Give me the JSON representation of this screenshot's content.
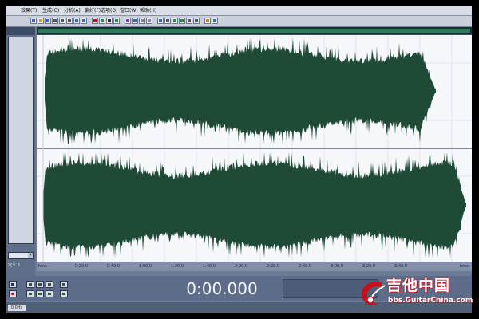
{
  "menu": {
    "items": [
      "效果(T)",
      "生成(G)",
      "分析(A)",
      "偏好(F)",
      "选项(O)",
      "窗口(W)",
      "帮助(H)"
    ]
  },
  "icons": {
    "toolbar": [
      "new-file-icon",
      "open-icon",
      "save-icon",
      "cut-icon",
      "copy-icon",
      "paste-icon",
      "undo-icon",
      "redo-icon",
      "record-icon",
      "play-icon",
      "stop-icon",
      "zoom-icon",
      "multitrack-icon",
      "edit-view-icon",
      "spectral-icon",
      "mix-icon",
      "loop-icon",
      "settings-icon",
      "marker-icon",
      "region-icon",
      "snap-icon",
      "grid-icon",
      "meter-icon",
      "cd-icon"
    ]
  },
  "left_panel": {
    "select_value": "",
    "footer_text": "定义 8"
  },
  "timeline": {
    "labels": [
      "hms",
      "0:20.0",
      "0:40.0",
      "1:00.0",
      "1:20.0",
      "1:40.0",
      "2:00.0",
      "2:20.0",
      "2:40.0",
      "3:00.0",
      "3:20.0",
      "3:40.0",
      "hms"
    ]
  },
  "transport": {
    "time": "0:00.000"
  },
  "status": {
    "tab_label": "0.0Hz"
  },
  "watermark": {
    "chinese": "吉他中国",
    "url": "bbs.GuitarChina.com"
  },
  "colors": {
    "waveform": "#1f4a35",
    "waveform_bg": "#f6f7fa",
    "app_blue": "#5d6c88",
    "watermark_red": "#c4111b"
  }
}
